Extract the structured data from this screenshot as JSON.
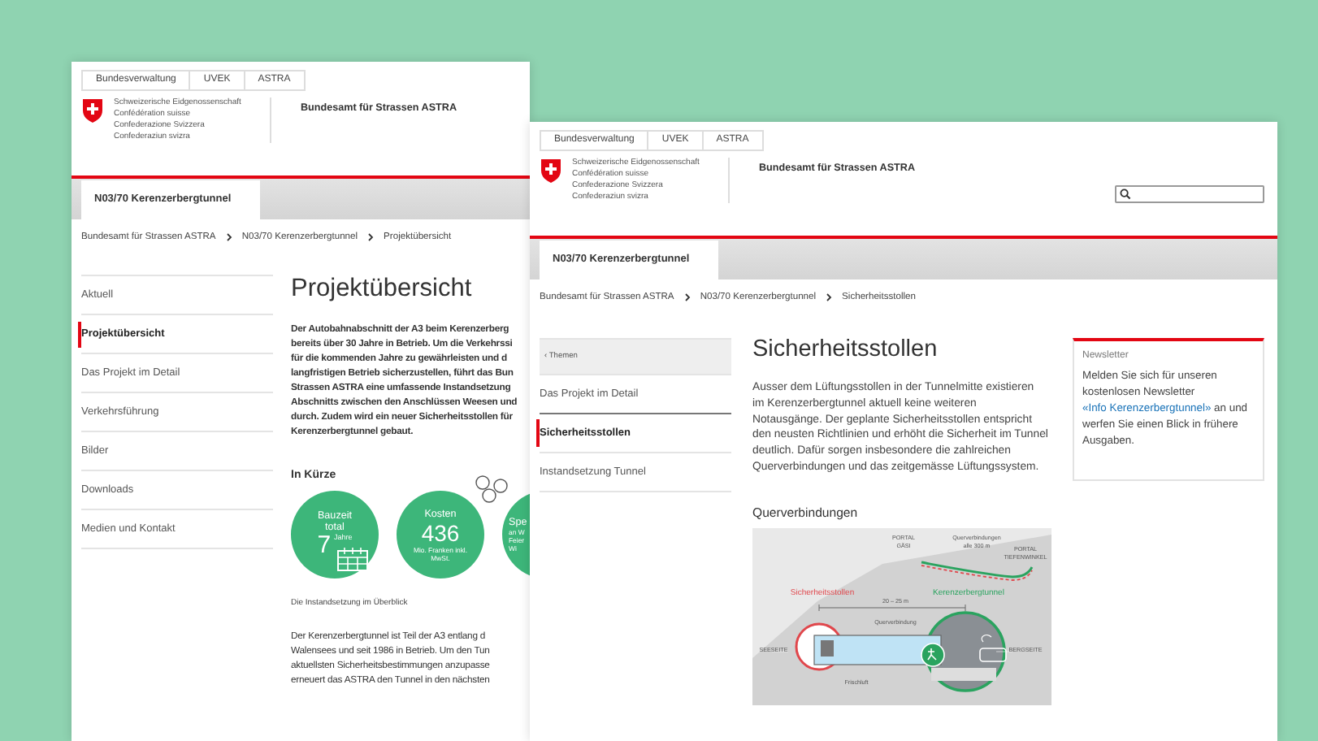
{
  "pages": [
    {
      "header": {
        "crumbs": [
          "Bundesverwaltung",
          "UVEK",
          "ASTRA"
        ],
        "confederation": [
          "Schweizerische Eidgenossenschaft",
          "Confédération suisse",
          "Confederazione Svizzera",
          "Confederaziun svizra"
        ],
        "office": "Bundesamt für Strassen ASTRA"
      },
      "tabs": [
        {
          "label": "N03/70 Kerenzerbergtunnel",
          "selected": true
        }
      ],
      "breadcrumb": [
        "Bundesamt für Strassen ASTRA",
        "N03/70 Kerenzerbergtunnel",
        "Projektübersicht"
      ],
      "sidebar": [
        {
          "kind": "link",
          "label": "Aktuell",
          "selected": false
        },
        {
          "kind": "link",
          "label": "Projektübersicht",
          "selected": true
        },
        {
          "kind": "link",
          "label": "Das Projekt im Detail",
          "selected": false
        },
        {
          "kind": "link",
          "label": "Verkehrsführung",
          "selected": false
        },
        {
          "kind": "link",
          "label": "Bilder",
          "selected": false
        },
        {
          "kind": "link",
          "label": "Downloads",
          "selected": false
        },
        {
          "kind": "link",
          "label": "Medien und Kontakt",
          "selected": false
        }
      ],
      "title": "Projektübersicht",
      "intro_lines": [
        "Der Autobahnabschnitt der A3 beim Kerenzerberg",
        "bereits über 30 Jahre in Betrieb. Um die Verkehrssi",
        "für die kommenden Jahre zu gewährleisten und d",
        "langfristigen Betrieb sicherzustellen, führt das Bun",
        "Strassen ASTRA eine umfassende Instandsetzung",
        "Abschnitts zwischen den Anschlüssen Weesen und",
        "durch. Zudem wird ein neuer Sicherheitsstollen für",
        "Kerenzerbergtunnel gebaut."
      ],
      "facts_heading": "In Kürze",
      "facts": [
        {
          "kind": "duration",
          "title": "Bauzeit total",
          "value": "7",
          "unit": "Jahre"
        },
        {
          "kind": "cost",
          "title": "Kosten",
          "value": "436",
          "note": "Mio. Franken inkl. MwSt."
        },
        {
          "kind": "partial",
          "title": "Spe",
          "note_lines": [
            "an W",
            "Feier",
            "Wi"
          ]
        }
      ],
      "facts_caption": "Die Instandsetzung im Überblick",
      "body_lines": [
        "Der Kerenzerbergtunnel ist Teil der A3 entlang d",
        "Walensees und seit 1986 in Betrieb. Um den Tun",
        "aktuellsten Sicherheitsbestimmungen anzupasse",
        "erneuert das ASTRA den Tunnel in den nächsten"
      ]
    },
    {
      "header": {
        "crumbs": [
          "Bundesverwaltung",
          "UVEK",
          "ASTRA"
        ],
        "confederation": [
          "Schweizerische Eidgenossenschaft",
          "Confédération suisse",
          "Confederazione Svizzera",
          "Confederaziun svizra"
        ],
        "office": "Bundesamt für Strassen ASTRA"
      },
      "search": true,
      "tabs": [
        {
          "label": "N03/70 Kerenzerbergtunnel",
          "selected": true
        }
      ],
      "breadcrumb": [
        "Bundesamt für Strassen ASTRA",
        "N03/70 Kerenzerbergtunnel",
        "Sicherheitsstollen"
      ],
      "sidebar": [
        {
          "kind": "back",
          "label": "‹ Themen",
          "selected": false
        },
        {
          "kind": "link",
          "label": "Das Projekt im Detail",
          "selected": false
        },
        {
          "kind": "link",
          "label": "Sicherheitsstollen",
          "selected": true
        },
        {
          "kind": "link",
          "label": "Instandsetzung Tunnel",
          "selected": false
        }
      ],
      "title": "Sicherheitsstollen",
      "paragraph": "Ausser dem Lüftungsstollen in der Tunnelmitte existieren im Kerenzerbergtunnel aktuell keine weiteren Notausgänge. Der geplante Sicherheitsstollen entspricht den neusten Richtlinien und erhöht die Sicherheit im Tunnel deutlich. Dafür sorgen insbesondere die zahlreichen Querverbindungen und das zeitgemässe Lüftungssystem.",
      "section_heading": "Querverbindungen",
      "diagram": {
        "labels": [
          {
            "lines": [
              "PORTAL",
              "GÄSI"
            ]
          },
          {
            "lines": [
              "Querverbindungen",
              "alle 300 m"
            ]
          },
          {
            "lines": [
              "PORTAL",
              "TIEFENWINKEL"
            ]
          },
          {
            "lines": [
              "Sicherheitsstollen"
            ]
          },
          {
            "lines": [
              "Kerenzerbergtunnel"
            ]
          },
          {
            "lines": [
              "20 – 25 m"
            ]
          },
          {
            "lines": [
              "Querverbindung"
            ]
          },
          {
            "lines": [
              "SEESEITE"
            ]
          },
          {
            "lines": [
              "BERGSEITE"
            ]
          },
          {
            "lines": [
              "Frischluft"
            ]
          }
        ]
      },
      "newsletter": {
        "heading": "Newsletter",
        "text_before": "Melden Sie sich für unseren kostenlosen Newsletter",
        "link": "«Info Kerenzerbergtunnel»",
        "text_after": "an und werfen Sie einen Blick in frühere Ausgaben."
      }
    }
  ]
}
